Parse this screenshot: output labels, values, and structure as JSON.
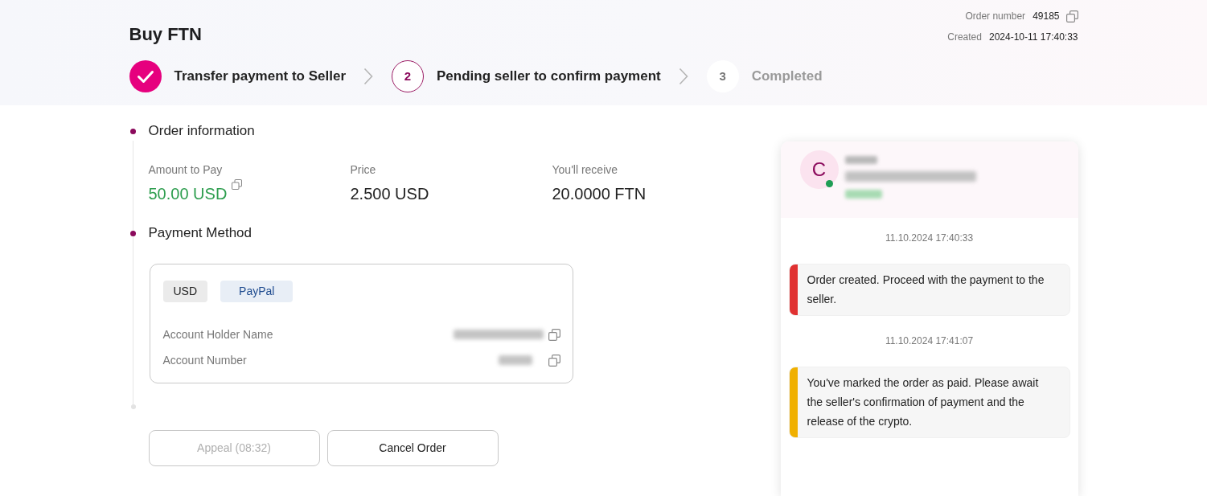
{
  "header": {
    "title": "Buy FTN",
    "order_number_label": "Order number",
    "order_number": "49185",
    "created_label": "Created",
    "created": "2024-10-11 17:40:33"
  },
  "steps": [
    {
      "kind": "done",
      "label": "Transfer payment to Seller"
    },
    {
      "kind": "current",
      "number": "2",
      "label": "Pending seller to confirm payment"
    },
    {
      "kind": "upcoming",
      "number": "3",
      "label": "Completed"
    }
  ],
  "order_information": {
    "title": "Order information",
    "fields": [
      {
        "label": "Amount to Pay",
        "value": "50.00 USD",
        "kind": "amount"
      },
      {
        "label": "Price",
        "value": "2.500 USD",
        "kind": "plain"
      },
      {
        "label": "You'll receive",
        "value": "20.0000 FTN",
        "kind": "plain"
      }
    ]
  },
  "payment_method": {
    "title": "Payment Method",
    "tags": [
      {
        "text": "USD",
        "kind": "currency"
      },
      {
        "text": "PayPal",
        "kind": "method"
      }
    ],
    "rows": [
      {
        "label": "Account Holder Name"
      },
      {
        "label": "Account Number"
      }
    ]
  },
  "buttons": [
    {
      "label": "Appeal (08:32)",
      "disabled": true
    },
    {
      "label": "Cancel Order",
      "disabled": false
    }
  ],
  "chat": {
    "avatar_letter": "C",
    "online": true,
    "events": [
      {
        "time": "11.10.2024 17:40:33",
        "text": "Order created. Proceed with the payment to the seller.",
        "color": "#e03131"
      },
      {
        "time": "11.10.2024 17:41:07",
        "text": "You've marked the order as paid. Please await the seller's confirmation of payment and the release of the crypto.",
        "color": "#f0b000"
      }
    ]
  }
}
